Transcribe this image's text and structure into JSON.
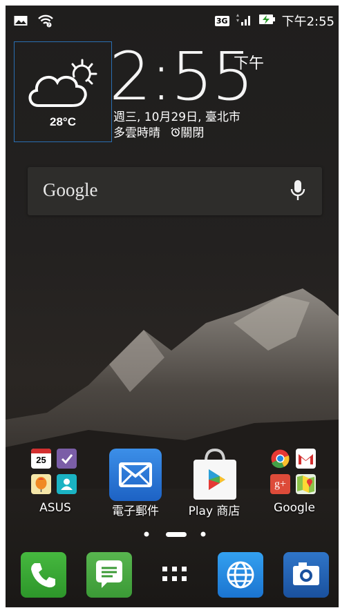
{
  "status_bar": {
    "network_label": "3G",
    "time": "下午2:55",
    "icons": [
      "image-icon",
      "wifi-icon",
      "signal-icon",
      "battery-charging-icon"
    ]
  },
  "weather": {
    "temperature": "28°C",
    "icon": "partly-cloudy-icon"
  },
  "clock": {
    "time": "2:55",
    "ampm": "下午",
    "date": "週三, 10月29日, 臺北市",
    "condition": "多雲時晴",
    "alarm": "關閉"
  },
  "search": {
    "logo": "Google",
    "mic_icon": "microphone-icon"
  },
  "apps": [
    {
      "label": "ASUS",
      "type": "folder",
      "calendar_day": "25"
    },
    {
      "label": "電子郵件",
      "type": "app"
    },
    {
      "label": "Play 商店",
      "type": "app"
    },
    {
      "label": "Google",
      "type": "folder"
    }
  ],
  "dock": [
    {
      "name": "phone",
      "color": "#3aa935"
    },
    {
      "name": "messages",
      "color": "#4caf50"
    },
    {
      "name": "app-drawer",
      "color": ""
    },
    {
      "name": "browser",
      "color": "#1e88e5"
    },
    {
      "name": "camera",
      "color": "#1e5fa8"
    }
  ],
  "colors": {
    "widget_border": "#2a6fb3",
    "search_bg": "#2e2d2b"
  }
}
